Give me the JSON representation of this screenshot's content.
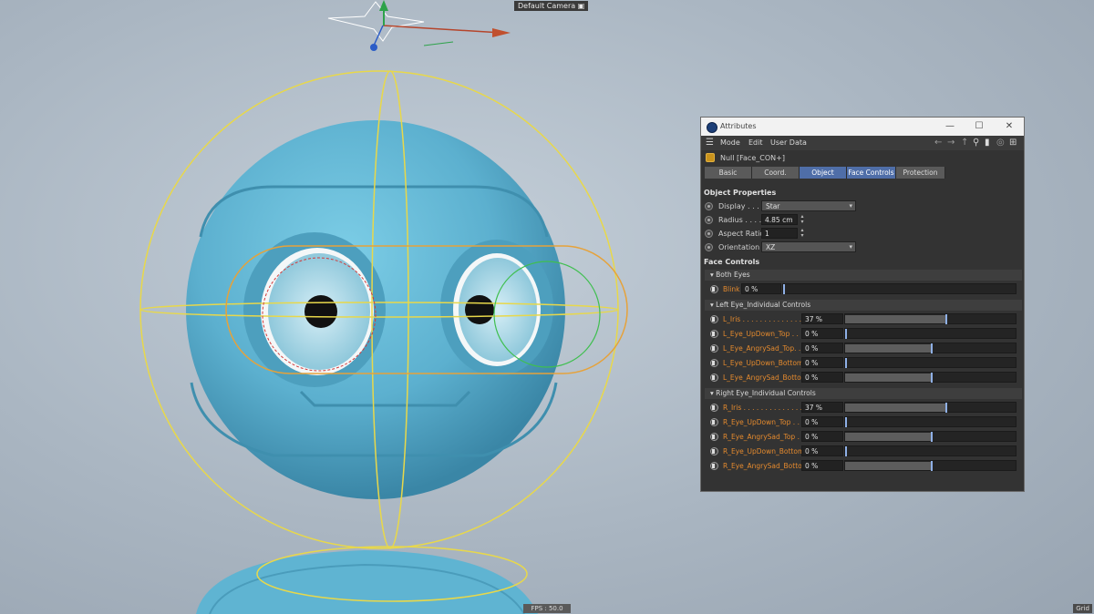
{
  "viewport": {
    "camera_label": "Default Camera",
    "fps_label": "FPS : 50.0",
    "grid_label": "Grid"
  },
  "attributes_panel": {
    "title": "Attributes",
    "window_buttons": {
      "minimize": "—",
      "maximize": "☐",
      "close": "✕"
    },
    "menu": [
      "Mode",
      "Edit",
      "User Data"
    ],
    "object_name": "Null [Face_CON+]",
    "tabs": [
      {
        "label": "Basic",
        "active": false
      },
      {
        "label": "Coord.",
        "active": false
      },
      {
        "label": "Object",
        "active": true
      },
      {
        "label": "Face Controls",
        "active": true
      },
      {
        "label": "Protection",
        "active": false
      }
    ],
    "object_properties": {
      "heading": "Object Properties",
      "display_label": "Display . . .",
      "display_value": "Star",
      "radius_label": "Radius . . . .",
      "radius_value": "4.85 cm",
      "aspect_label": "Aspect Ratio",
      "aspect_value": "1",
      "orientation_label": "Orientation",
      "orientation_value": "XZ"
    },
    "face_controls": {
      "heading": "Face Controls",
      "groups": [
        {
          "title": "Both Eyes",
          "sliders": [
            {
              "label": "Blink",
              "value": "0 %",
              "fraction": 0.0
            }
          ]
        },
        {
          "title": "Left Eye_Individual Controls",
          "sliders": [
            {
              "label": "L_Iris . . . . . . . . . . . . . .",
              "value": "37 %",
              "fraction": 0.59
            },
            {
              "label": "L_Eye_UpDown_Top . . .",
              "value": "0 %",
              "fraction": 0.0
            },
            {
              "label": "L_Eye_AngrySad_Top. . .",
              "value": "0 %",
              "fraction": 0.5
            },
            {
              "label": "L_Eye_UpDown_Bottom",
              "value": "0 %",
              "fraction": 0.0
            },
            {
              "label": "L_Eye_AngrySad_Bottom",
              "value": "0 %",
              "fraction": 0.5
            }
          ]
        },
        {
          "title": "Right Eye_Individual Controls",
          "sliders": [
            {
              "label": "R_Iris . . . . . . . . . . . . . .",
              "value": "37 %",
              "fraction": 0.59
            },
            {
              "label": "R_Eye_UpDown_Top . . .",
              "value": "0 %",
              "fraction": 0.0
            },
            {
              "label": "R_Eye_AngrySad_Top . .",
              "value": "0 %",
              "fraction": 0.5
            },
            {
              "label": "R_Eye_UpDown_Bottom",
              "value": "0 %",
              "fraction": 0.0
            },
            {
              "label": "R_Eye_AngrySad_Bottom",
              "value": "0 %",
              "fraction": 0.5
            }
          ]
        }
      ]
    }
  },
  "colors": {
    "panel_bg": "#333333",
    "active_tab": "#4f6ea8",
    "param_label": "#e48a2e",
    "slider_handle": "#8fb0e6",
    "robot_body": "#64b8d6"
  }
}
